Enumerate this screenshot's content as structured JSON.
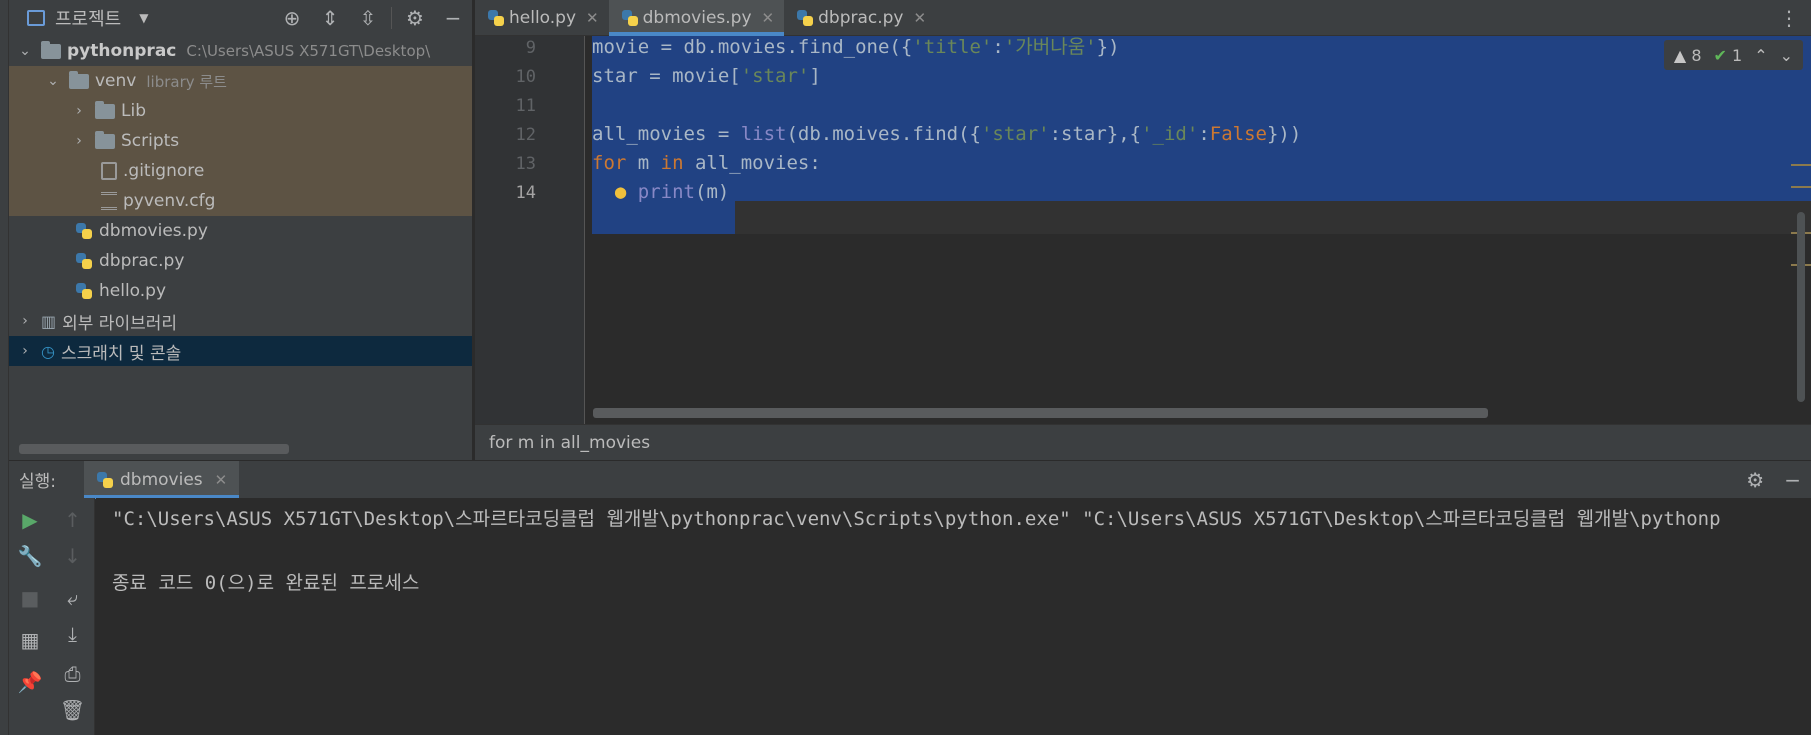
{
  "project": {
    "title": "프로젝트",
    "tree": [
      {
        "label": "pythonprac",
        "path": "C:\\Users\\ASUS X571GT\\Desktop\\"
      },
      {
        "label": "venv",
        "note": "library 루트"
      },
      {
        "label": "Lib"
      },
      {
        "label": "Scripts"
      },
      {
        "label": ".gitignore"
      },
      {
        "label": "pyvenv.cfg"
      },
      {
        "label": "dbmovies.py"
      },
      {
        "label": "dbprac.py"
      },
      {
        "label": "hello.py"
      },
      {
        "label": "외부 라이브러리"
      },
      {
        "label": "스크래치 및 콘솔"
      }
    ]
  },
  "tabs": [
    {
      "label": "hello.py"
    },
    {
      "label": "dbmovies.py"
    },
    {
      "label": "dbprac.py"
    }
  ],
  "editor": {
    "line_numbers": [
      "9",
      "10",
      "11",
      "12",
      "13",
      "14"
    ],
    "inspection": {
      "warnings": "8",
      "ok": "1"
    }
  },
  "breadcrumb": "for m in all_movies",
  "run": {
    "label": "실행:",
    "tab": "dbmovies",
    "console": [
      "\"C:\\Users\\ASUS X571GT\\Desktop\\스파르타코딩클럽 웹개발\\pythonprac\\venv\\Scripts\\python.exe\" \"C:\\Users\\ASUS X571GT\\Desktop\\스파르타코딩클럽 웹개발\\pythonp",
      "종료 코드 0(으)로 완료된 프로세스"
    ]
  }
}
